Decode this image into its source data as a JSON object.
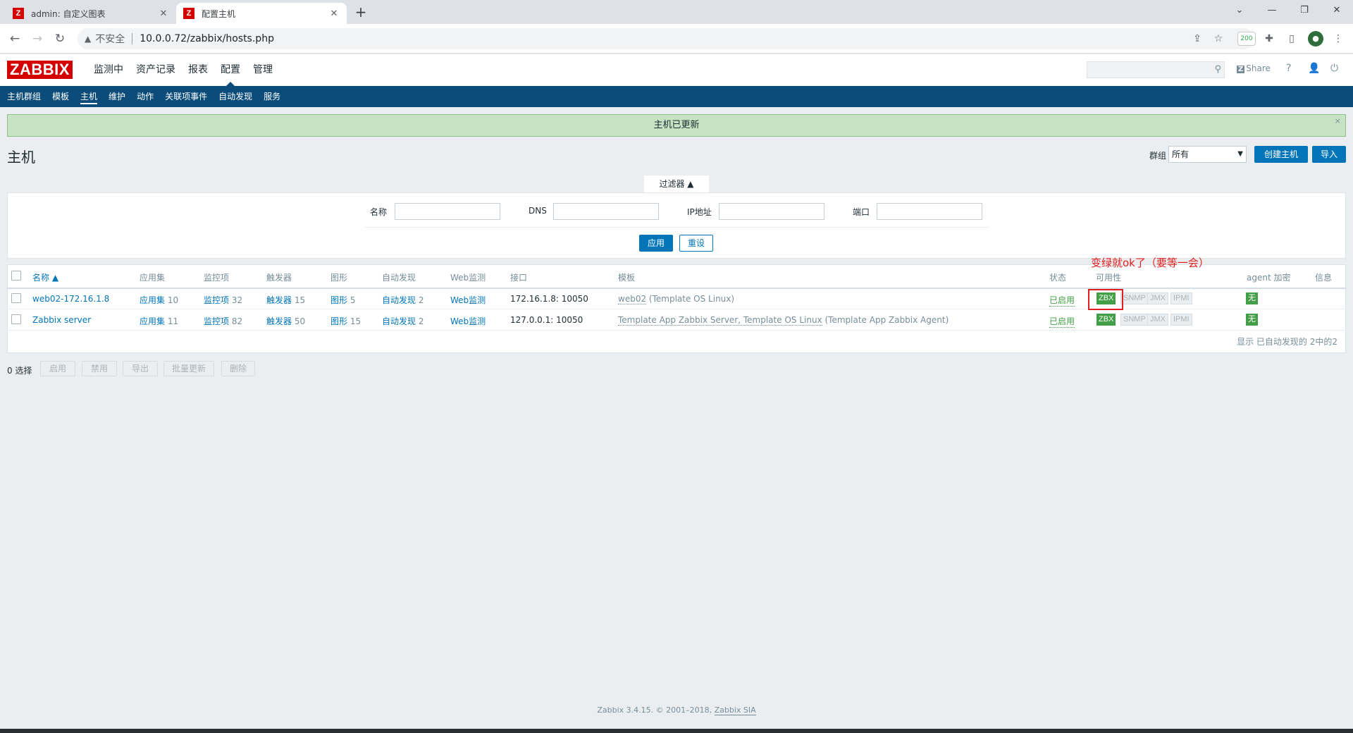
{
  "browser": {
    "tabs": [
      {
        "title": "admin: 自定义图表",
        "favicon": "Z"
      },
      {
        "title": "配置主机",
        "favicon": "Z"
      }
    ],
    "new_tab": "+",
    "insecure_label": "不安全",
    "url": "10.0.0.72/zabbix/hosts.php",
    "ext_badge": "200"
  },
  "zabbix": {
    "logo": "ZABBIX",
    "top_menu": [
      "监测中",
      "资产记录",
      "报表",
      "配置",
      "管理"
    ],
    "share": "Share",
    "share_mark": "Z",
    "help": "?",
    "sub_menu": [
      "主机群组",
      "模板",
      "主机",
      "维护",
      "动作",
      "关联项事件",
      "自动发现",
      "服务"
    ]
  },
  "message": {
    "text": "主机已更新",
    "close": "×"
  },
  "page": {
    "title": "主机",
    "group_label": "群组",
    "group_value": "所有",
    "create_button": "创建主机",
    "import_button": "导入"
  },
  "filter": {
    "tab_label": "过滤器 ▲",
    "name_label": "名称",
    "dns_label": "DNS",
    "ip_label": "IP地址",
    "port_label": "端口",
    "apply": "应用",
    "reset": "重设"
  },
  "table": {
    "headers": {
      "name": "名称 ▲",
      "applications": "应用集",
      "items": "监控项",
      "triggers": "触发器",
      "graphs": "图形",
      "discovery": "自动发现",
      "web": "Web监测",
      "interface": "接口",
      "templates": "模板",
      "status": "状态",
      "availability": "可用性",
      "encryption": "agent 加密",
      "info": "信息"
    },
    "rows": [
      {
        "name": "web02-172.16.1.8",
        "apps_label": "应用集",
        "apps_count": "10",
        "items_label": "监控项",
        "items_count": "32",
        "triggers_label": "触发器",
        "triggers_count": "15",
        "graphs_label": "图形",
        "graphs_count": "5",
        "discovery_label": "自动发现",
        "discovery_count": "2",
        "web_label": "Web监测",
        "interface": "172.16.1.8: 10050",
        "templates_linked": "web02",
        "templates_parent": "(Template OS Linux)",
        "status": "已启用",
        "avail": [
          "ZBX",
          "SNMP",
          "JMX",
          "IPMI"
        ],
        "encryption": "无"
      },
      {
        "name": "Zabbix server",
        "apps_label": "应用集",
        "apps_count": "11",
        "items_label": "监控项",
        "items_count": "82",
        "triggers_label": "触发器",
        "triggers_count": "50",
        "graphs_label": "图形",
        "graphs_count": "15",
        "discovery_label": "自动发现",
        "discovery_count": "2",
        "web_label": "Web监测",
        "interface": "127.0.0.1: 10050",
        "templates_linked": "Template App Zabbix Server, Template OS Linux",
        "templates_parent": "(Template App Zabbix Agent)",
        "status": "已启用",
        "avail": [
          "ZBX",
          "SNMP",
          "JMX",
          "IPMI"
        ],
        "encryption": "无"
      }
    ],
    "footer": "显示 已自动发现的 2中的2"
  },
  "annotation": "变绿就ok了（要等一会）",
  "bulk": {
    "selected": "0 选择",
    "buttons": [
      "启用",
      "禁用",
      "导出",
      "批量更新",
      "删除"
    ]
  },
  "footer": {
    "text": "Zabbix 3.4.15. © 2001–2018,",
    "link": "Zabbix SIA"
  },
  "colors": {
    "brand": "#d40000",
    "nav": "#0b4c7a",
    "primary": "#0275b8",
    "ok": "#429e47",
    "annotation": "#e02020"
  }
}
